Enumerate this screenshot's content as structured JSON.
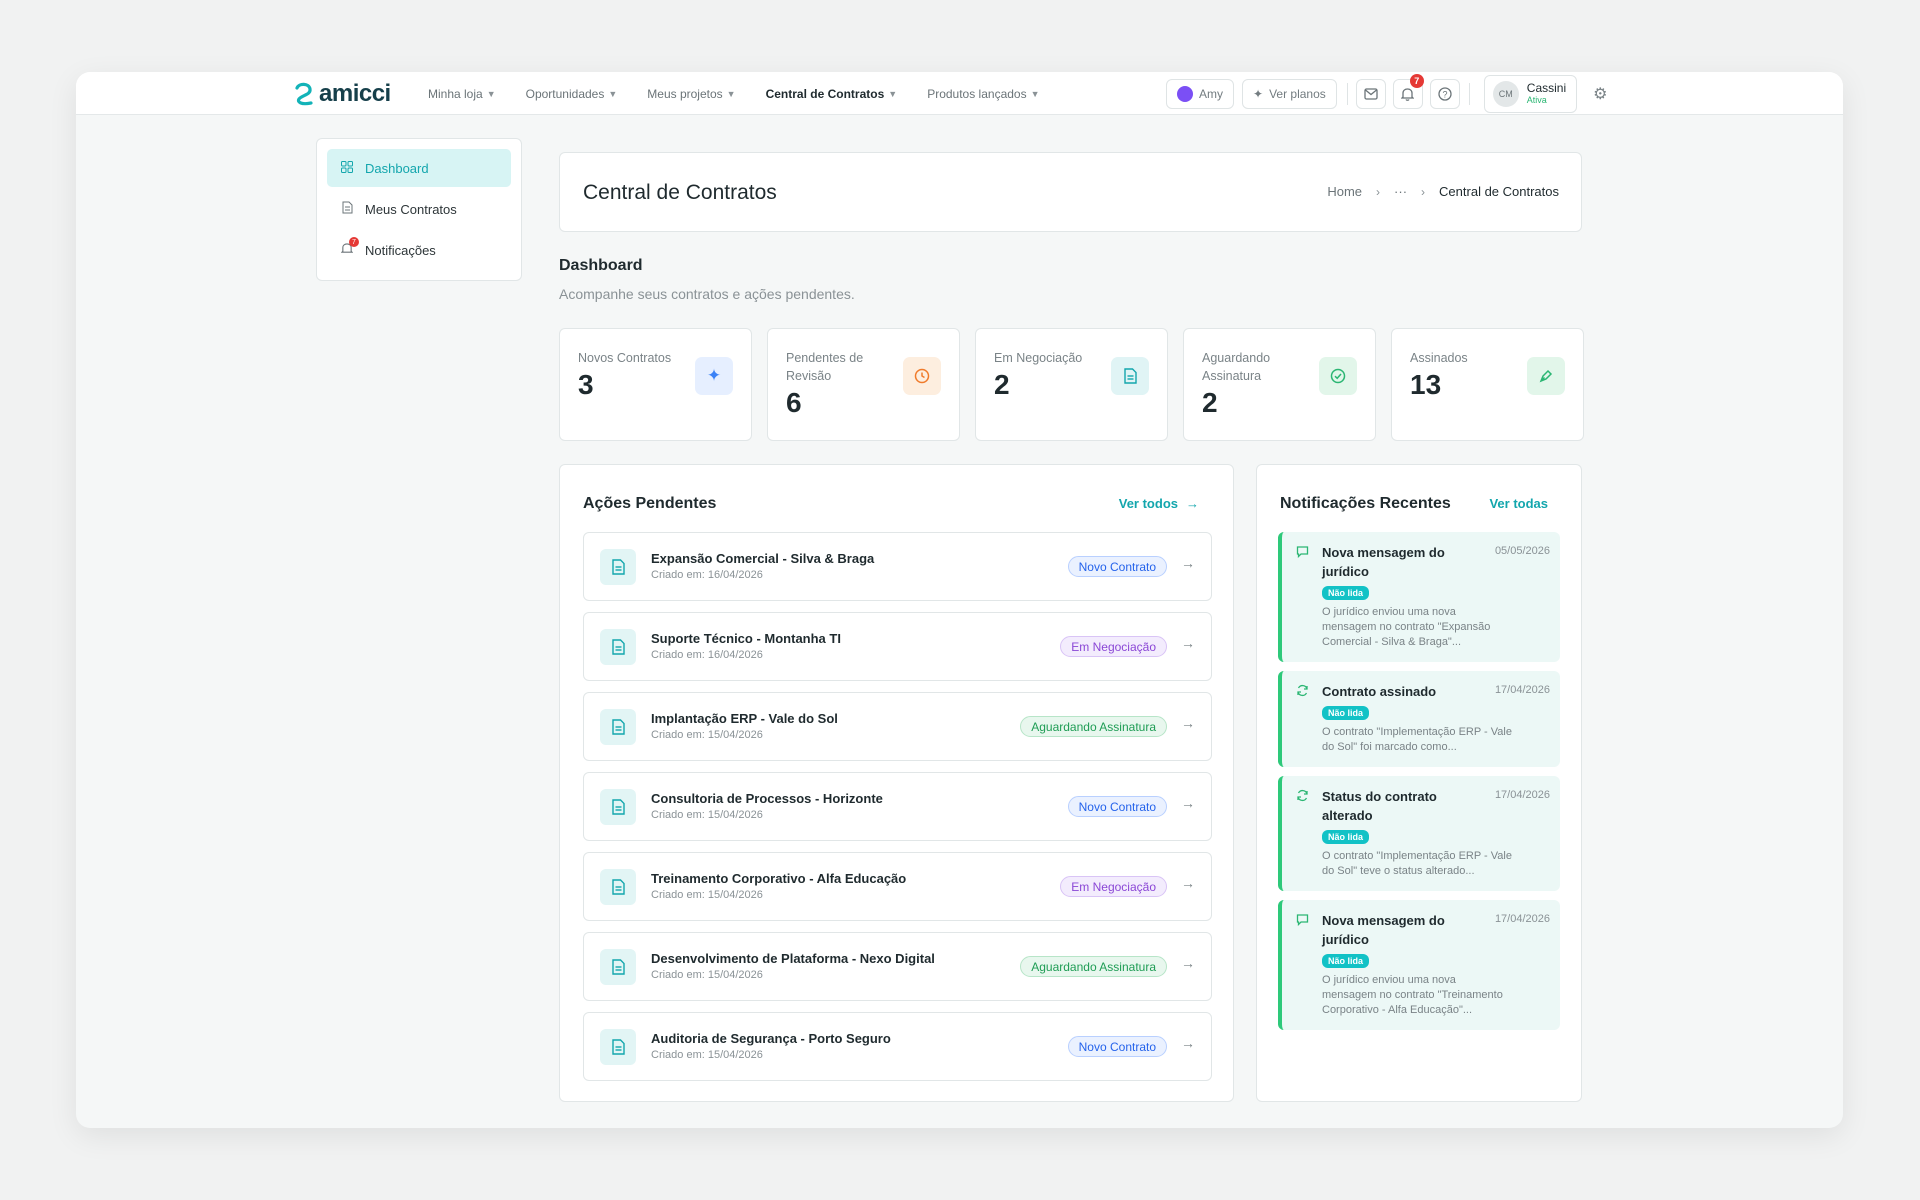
{
  "brand": {
    "name": "amicci"
  },
  "nav": {
    "items": [
      {
        "label": "Minha loja",
        "active": false
      },
      {
        "label": "Oportunidades",
        "active": false
      },
      {
        "label": "Meus projetos",
        "active": false
      },
      {
        "label": "Central de Contratos",
        "active": true
      },
      {
        "label": "Produtos lançados",
        "active": false
      }
    ],
    "amy_label": "Amy",
    "plans_label": "Ver planos",
    "notification_count": "7",
    "user": {
      "initials": "CM",
      "name": "Cassini",
      "status": "Ativa"
    }
  },
  "sidebar": {
    "items": [
      {
        "label": "Dashboard",
        "icon": "grid-icon",
        "active": true
      },
      {
        "label": "Meus Contratos",
        "icon": "document-icon",
        "active": false
      },
      {
        "label": "Notificações",
        "icon": "bell-icon",
        "active": false,
        "badge": "7"
      }
    ]
  },
  "header": {
    "title": "Central de Contratos",
    "breadcrumb": [
      "Home",
      "···",
      "Central de Contratos"
    ]
  },
  "section": {
    "title": "Dashboard",
    "subtitle": "Acompanhe seus contratos e ações pendentes."
  },
  "stats": [
    {
      "label": "Novos Contratos",
      "value": "3",
      "icon": "sparkles-icon",
      "color": "#3b82f6",
      "bg": "#e6efff"
    },
    {
      "label": "Pendentes de Revisão",
      "value": "6",
      "icon": "clock-icon",
      "color": "#f07b2b",
      "bg": "#fdeedf"
    },
    {
      "label": "Em Negociação",
      "value": "2",
      "icon": "document-icon",
      "color": "#13a6ad",
      "bg": "#e0f4f5"
    },
    {
      "label": "Aguardando Assinatura",
      "value": "2",
      "icon": "check-circle-icon",
      "color": "#2bb673",
      "bg": "#e2f6ea"
    },
    {
      "label": "Assinados",
      "value": "13",
      "icon": "pen-icon",
      "color": "#2bb673",
      "bg": "#e2f6ea"
    }
  ],
  "acoes": {
    "title": "Ações Pendentes",
    "link": "Ver todos",
    "rows": [
      {
        "name": "Expansão Comercial - Silva & Braga",
        "date": "Criado em: 16/04/2026",
        "status": "Novo Contrato",
        "kind": "novo"
      },
      {
        "name": "Suporte Técnico - Montanha TI",
        "date": "Criado em: 16/04/2026",
        "status": "Em Negociação",
        "kind": "negociacao"
      },
      {
        "name": "Implantação ERP - Vale do Sol",
        "date": "Criado em: 15/04/2026",
        "status": "Aguardando Assinatura",
        "kind": "assinatura"
      },
      {
        "name": "Consultoria de Processos - Horizonte",
        "date": "Criado em: 15/04/2026",
        "status": "Novo Contrato",
        "kind": "novo"
      },
      {
        "name": "Treinamento Corporativo - Alfa Educação",
        "date": "Criado em: 15/04/2026",
        "status": "Em Negociação",
        "kind": "negociacao"
      },
      {
        "name": "Desenvolvimento de Plataforma - Nexo Digital",
        "date": "Criado em: 15/04/2026",
        "status": "Aguardando Assinatura",
        "kind": "assinatura"
      },
      {
        "name": "Auditoria de Segurança - Porto Seguro",
        "date": "Criado em: 15/04/2026",
        "status": "Novo Contrato",
        "kind": "novo"
      }
    ]
  },
  "notificacoes": {
    "title": "Notificações Recentes",
    "link": "Ver todas",
    "items": [
      {
        "title": "Nova mensagem do jurídico",
        "date": "05/05/2026",
        "badge": "Não lida",
        "text": "O jurídico enviou uma nova mensagem no contrato \"Expansão Comercial - Silva & Braga\"...",
        "icon": "message-icon"
      },
      {
        "title": "Contrato assinado",
        "date": "17/04/2026",
        "badge": "Não lida",
        "text": "O contrato \"Implementação ERP - Vale do Sol\" foi marcado como...",
        "icon": "refresh-icon"
      },
      {
        "title": "Status do contrato alterado",
        "date": "17/04/2026",
        "badge": "Não lida",
        "text": "O contrato \"Implementação ERP - Vale do Sol\" teve o status alterado...",
        "icon": "refresh-icon"
      },
      {
        "title": "Nova mensagem do jurídico",
        "date": "17/04/2026",
        "badge": "Não lida",
        "text": "O jurídico enviou uma nova mensagem no contrato \"Treinamento Corporativo - Alfa Educação\"...",
        "icon": "message-icon"
      }
    ]
  },
  "colors": {
    "accent": "#13a6ad",
    "unread_badge": "#12c2c6",
    "notif_border": "#2ec97a"
  }
}
